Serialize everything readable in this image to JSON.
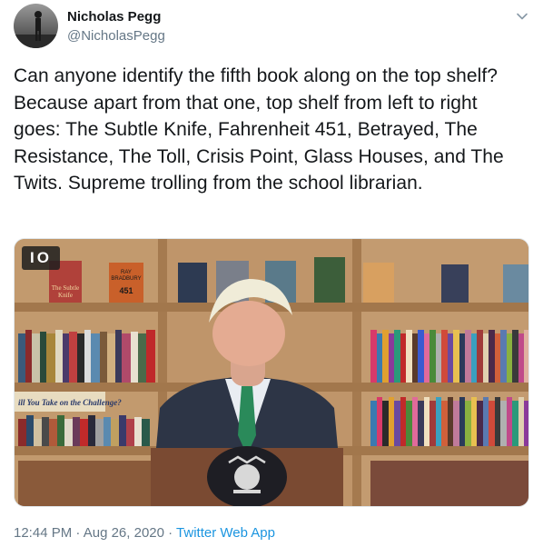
{
  "user": {
    "name": "Nicholas Pegg",
    "handle": "@NicholasPegg"
  },
  "tweet": {
    "text": "Can anyone identify the fifth book along on the top shelf? Because apart from that one, top shelf from left to right goes: The Subtle Knife, Fahrenheit 451, Betrayed, The Resistance, The Toll, Crisis Point, Glass Houses, and The Twits. Supreme trolling from the school librarian."
  },
  "media": {
    "badge": "IO",
    "sign_text": "ill You Take on the Challenge?",
    "book_labels": [
      "The Subtle Knife",
      "RAY BRADBURY",
      "451"
    ]
  },
  "meta": {
    "time": "12:44 PM",
    "separator": " · ",
    "date": "Aug 26, 2020",
    "separator2": " · ",
    "source": "Twitter Web App"
  },
  "icons": {
    "caret": "chevron-down-icon"
  },
  "colors": {
    "text": "#14171a",
    "secondary": "#657786",
    "link": "#1b95e0"
  }
}
